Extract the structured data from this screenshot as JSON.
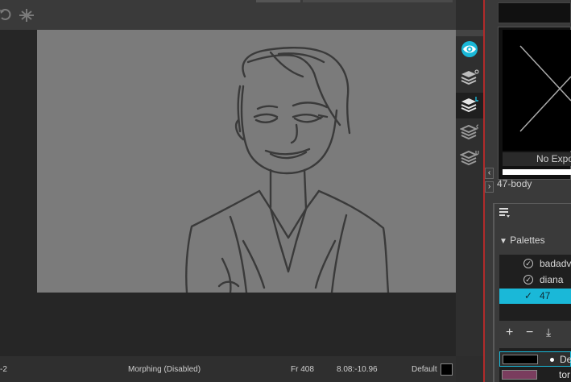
{
  "toolbar": {
    "icons": [
      "rotate-icon",
      "transform-icon"
    ]
  },
  "status": {
    "frame_prefix": "-2",
    "morphing": "Morphing (Disabled)",
    "frame": "Fr 408",
    "range": "8.08:-10.96",
    "default_label": "Default",
    "default_color": "#000000"
  },
  "view_modes": [
    "onion-skin-eye-icon",
    "layers-o-icon",
    "layers-l-icon",
    "layers-c-icon",
    "layers-u-icon"
  ],
  "view_mode_letters": [
    "o",
    "L",
    "c",
    "u"
  ],
  "preview": {
    "no_exposure_label": "No Expo"
  },
  "layer": {
    "name": "47-body"
  },
  "palettes": {
    "heading": "Palettes",
    "items": [
      {
        "name": "badadv",
        "selected": false
      },
      {
        "name": "diana",
        "selected": false
      },
      {
        "name": "47",
        "selected": true
      }
    ],
    "tools": {
      "add": "+",
      "remove": "−",
      "import": "⤓"
    }
  },
  "swatches": [
    {
      "name": "De",
      "color": "#000000",
      "selected": true
    },
    {
      "name": "tor",
      "color": "#7a3d5e",
      "selected": false
    }
  ],
  "colors": {
    "accent": "#1ab8d8",
    "separator": "#b02a2a",
    "canvas": "#7b7b7b"
  }
}
